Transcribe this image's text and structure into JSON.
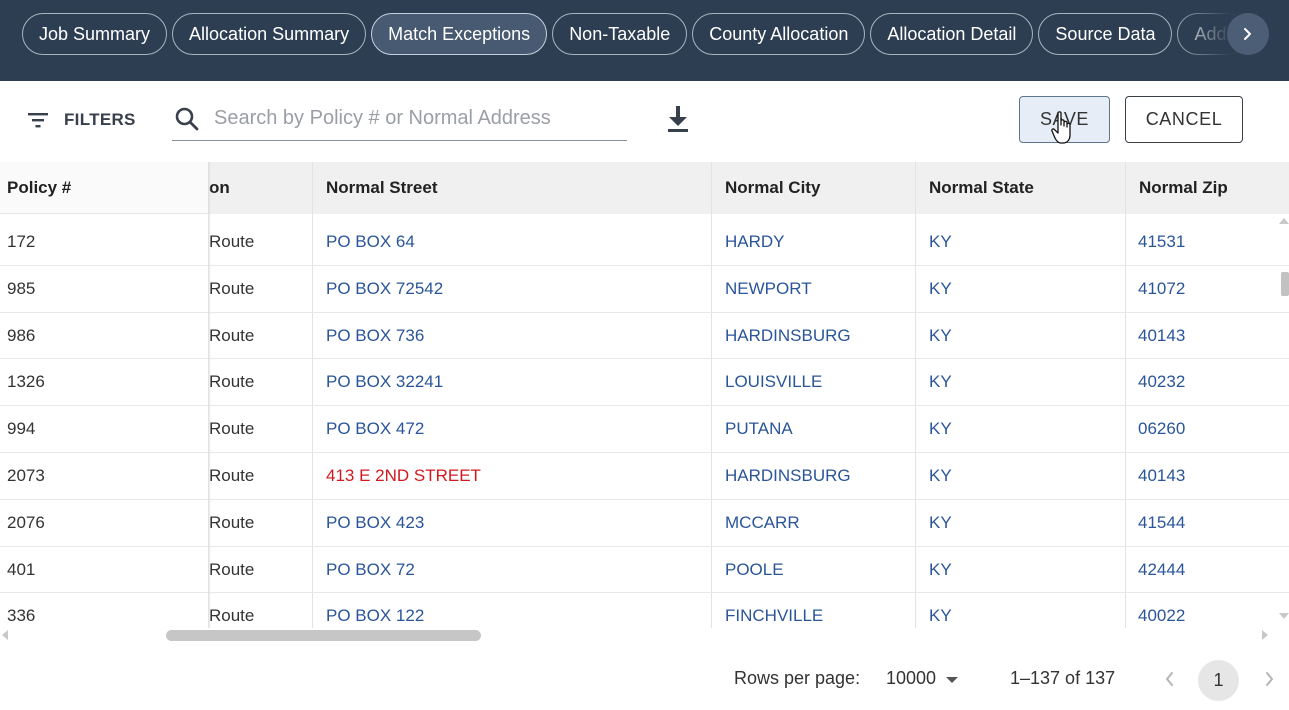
{
  "tabs": [
    {
      "label": "Job Summary",
      "active": false
    },
    {
      "label": "Allocation Summary",
      "active": false
    },
    {
      "label": "Match Exceptions",
      "active": true
    },
    {
      "label": "Non-Taxable",
      "active": false
    },
    {
      "label": "County Allocation",
      "active": false
    },
    {
      "label": "Allocation Detail",
      "active": false
    },
    {
      "label": "Source Data",
      "active": false
    },
    {
      "label": "Addi",
      "active": false
    }
  ],
  "toolbar": {
    "filters_label": "FILTERS",
    "search_placeholder": "Search by Policy # or Normal Address",
    "search_value": "",
    "save_label": "SAVE",
    "cancel_label": "CANCEL"
  },
  "table": {
    "headers": {
      "policy": "Policy #",
      "partial": "on",
      "street": "Normal Street",
      "city": "Normal City",
      "state": "Normal State",
      "zip": "Normal Zip"
    },
    "rows": [
      {
        "policy": "172",
        "partial": "Route",
        "street": "PO BOX 64",
        "city": "HARDY",
        "state": "KY",
        "zip": "41531",
        "street_error": false
      },
      {
        "policy": "985",
        "partial": "Route",
        "street": "PO BOX 72542",
        "city": "NEWPORT",
        "state": "KY",
        "zip": "41072",
        "street_error": false
      },
      {
        "policy": "986",
        "partial": "Route",
        "street": "PO BOX 736",
        "city": "HARDINSBURG",
        "state": "KY",
        "zip": "40143",
        "street_error": false
      },
      {
        "policy": "1326",
        "partial": "Route",
        "street": "PO BOX 32241",
        "city": "LOUISVILLE",
        "state": "KY",
        "zip": "40232",
        "street_error": false
      },
      {
        "policy": "994",
        "partial": "Route",
        "street": "PO BOX 472",
        "city": "PUTANA",
        "state": "KY",
        "zip": "06260",
        "street_error": false
      },
      {
        "policy": "2073",
        "partial": "Route",
        "street": "413 E 2ND STREET",
        "city": "HARDINSBURG",
        "state": "KY",
        "zip": "40143",
        "street_error": true
      },
      {
        "policy": "2076",
        "partial": "Route",
        "street": "PO BOX 423",
        "city": "MCCARR",
        "state": "KY",
        "zip": "41544",
        "street_error": false
      },
      {
        "policy": "401",
        "partial": "Route",
        "street": "PO BOX 72",
        "city": "POOLE",
        "state": "KY",
        "zip": "42444",
        "street_error": false
      },
      {
        "policy": "336",
        "partial": "Route",
        "street": "PO BOX 122",
        "city": "FINCHVILLE",
        "state": "KY",
        "zip": "40022",
        "street_error": false
      }
    ]
  },
  "footer": {
    "rows_per_page_label": "Rows per page:",
    "rows_per_page_value": "10000",
    "range_text": "1–137 of 137",
    "current_page": "1"
  },
  "colors": {
    "header_bg": "#2d3d52",
    "link_blue": "#2a5599",
    "error_red": "#d0191f"
  }
}
